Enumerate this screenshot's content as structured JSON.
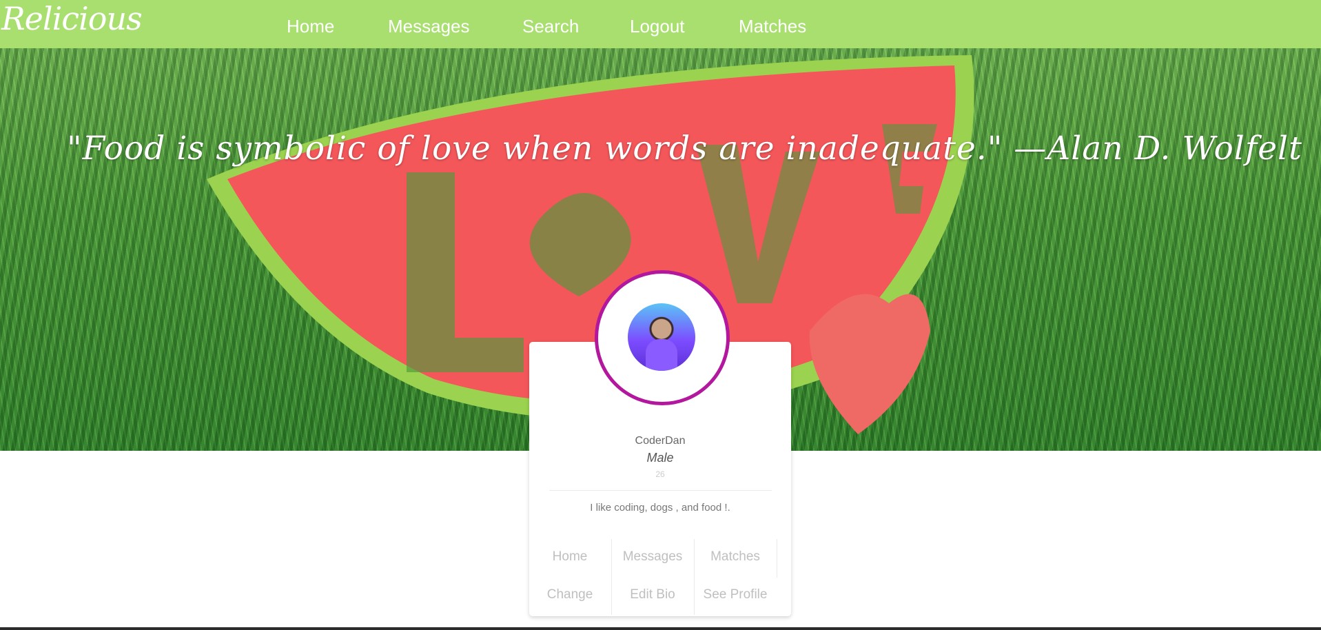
{
  "brand": "Relicious",
  "nav": {
    "items": [
      {
        "label": "Home"
      },
      {
        "label": "Messages"
      },
      {
        "label": "Search"
      },
      {
        "label": "Logout"
      },
      {
        "label": "Matches"
      }
    ]
  },
  "hero": {
    "quote": "\"Food is symbolic of love when words are inadequate.\" —Alan D. Wolfelt"
  },
  "profile": {
    "username": "CoderDan",
    "gender": "Male",
    "age": "26",
    "bio": "I like coding, dogs , and food !."
  },
  "card_actions": {
    "row1": [
      {
        "label": "Home"
      },
      {
        "label": "Messages"
      },
      {
        "label": "Matches"
      }
    ],
    "row2": [
      {
        "label": "Change"
      },
      {
        "label": "Edit Bio"
      },
      {
        "label": "See Profile"
      }
    ]
  },
  "colors": {
    "nav_background": "#a8df6f",
    "avatar_ring": "#b3179d"
  }
}
